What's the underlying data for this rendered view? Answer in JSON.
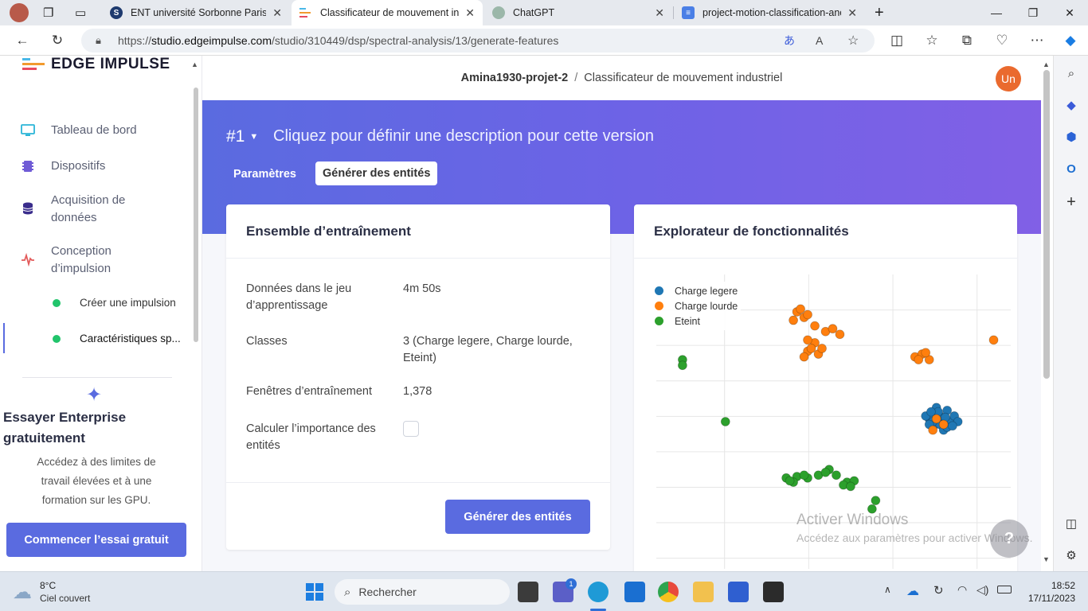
{
  "browser": {
    "tabs": [
      {
        "title": "ENT université Sorbonne Paris No",
        "icon": "sorbonne-icon",
        "color": "#1e3a6e"
      },
      {
        "title": "Classificateur de mouvement ind",
        "icon": "edge-impulse-icon",
        "color": "#ffffff",
        "active": true
      },
      {
        "title": "ChatGPT",
        "icon": "chatgpt-icon",
        "color": "#9bb7a9"
      },
      {
        "title": "project-motion-classification-anc",
        "icon": "docs-icon",
        "color": "#4a7fe6"
      }
    ],
    "url_prefix": "https://",
    "url_host": "studio.edgeimpulse.com",
    "url_path": "/studio/310449/dsp/spectral-analysis/13/generate-features"
  },
  "sidebar": {
    "logo": "EDGE IMPULSE",
    "items": [
      {
        "label": "Tableau de bord",
        "icon": "monitor-icon",
        "color": "#2bb5d8"
      },
      {
        "label": "Dispositifs",
        "icon": "chip-icon",
        "color": "#6f5bd6"
      },
      {
        "label": "Acquisition de\ndonnées",
        "icon": "database-icon",
        "color": "#3a2d8c"
      },
      {
        "label": "Conception\nd’impulsion",
        "icon": "pulse-icon",
        "color": "#e35b5b"
      }
    ],
    "subitems": [
      {
        "label": "Créer une impulsion"
      },
      {
        "label": "Caractéristiques sp..."
      }
    ],
    "enterprise_title": "Essayer Enterprise\ngratuitement",
    "enterprise_desc": "Accédez à des limites de\ntravail élevées et à une\nformation sur les GPU.",
    "enterprise_button": "Commencer l’essai gratuit"
  },
  "header": {
    "project": "Amina1930-projet-2",
    "separator": "/",
    "title": "Classificateur de mouvement industriel",
    "avatar": "Un"
  },
  "version": {
    "number": "#1",
    "description": "Cliquez pour définir une description pour cette version",
    "tabs": [
      "Paramètres",
      "Générer des entités"
    ]
  },
  "training": {
    "title": "Ensemble d’entraînement",
    "rows": [
      {
        "label": "Données dans le jeu\nd’apprentissage",
        "value": "4m 50s"
      },
      {
        "label": "Classes",
        "value": "3 (Charge legere, Charge lourde,\nEteint)"
      },
      {
        "label": "Fenêtres d’entraînement",
        "value": "1,378"
      },
      {
        "label": "Calculer l’importance des\nentités",
        "value": ""
      }
    ],
    "button": "Générer des entités"
  },
  "explorer": {
    "title": "Explorateur de fonctionnalités",
    "watermark_title": "Activer Windows",
    "watermark_desc": "Accédez aux paramètres pour activer Windows."
  },
  "chart_data": {
    "type": "scatter",
    "title": "",
    "xlabel": "",
    "ylabel": "",
    "grid": true,
    "legend": "top-left",
    "xlim": [
      0,
      10
    ],
    "ylim": [
      0,
      10
    ],
    "series": [
      {
        "name": "Charge legere",
        "color": "#1f77b4",
        "points": [
          [
            7.9,
            5.1
          ],
          [
            8.1,
            5.3
          ],
          [
            8.3,
            5.0
          ],
          [
            8.0,
            4.8
          ],
          [
            8.4,
            5.4
          ],
          [
            8.2,
            4.9
          ],
          [
            7.8,
            5.2
          ],
          [
            8.5,
            5.0
          ],
          [
            8.1,
            5.5
          ],
          [
            8.3,
            4.7
          ],
          [
            8.6,
            5.2
          ],
          [
            8.0,
            5.0
          ],
          [
            7.9,
            4.9
          ],
          [
            8.2,
            5.2
          ],
          [
            8.4,
            4.8
          ],
          [
            8.7,
            5.0
          ],
          [
            8.15,
            5.35
          ],
          [
            8.35,
            5.15
          ],
          [
            8.55,
            4.85
          ],
          [
            7.95,
            5.35
          ]
        ]
      },
      {
        "name": "Charge lourde",
        "color": "#ff7f0e",
        "points": [
          [
            4.2,
            8.9
          ],
          [
            4.4,
            8.7
          ],
          [
            4.1,
            8.6
          ],
          [
            4.3,
            9.0
          ],
          [
            4.5,
            8.8
          ],
          [
            5.0,
            8.2
          ],
          [
            5.2,
            8.3
          ],
          [
            5.4,
            8.1
          ],
          [
            4.5,
            7.5
          ],
          [
            4.7,
            7.8
          ],
          [
            4.4,
            7.3
          ],
          [
            4.6,
            7.6
          ],
          [
            4.8,
            7.4
          ],
          [
            4.5,
            7.9
          ],
          [
            4.9,
            7.6
          ],
          [
            7.5,
            7.3
          ],
          [
            7.7,
            7.4
          ],
          [
            7.9,
            7.2
          ],
          [
            7.6,
            7.2
          ],
          [
            7.8,
            7.45
          ],
          [
            9.7,
            7.9
          ],
          [
            8.1,
            5.1
          ],
          [
            8.3,
            4.9
          ],
          [
            8.0,
            4.7
          ],
          [
            4.7,
            8.4
          ]
        ]
      },
      {
        "name": "Eteint",
        "color": "#2ca02c",
        "points": [
          [
            1.0,
            7.2
          ],
          [
            1.0,
            7.0
          ],
          [
            2.2,
            5.0
          ],
          [
            3.9,
            3.0
          ],
          [
            4.2,
            3.05
          ],
          [
            4.1,
            2.85
          ],
          [
            4.5,
            3.0
          ],
          [
            4.8,
            3.1
          ],
          [
            5.1,
            3.3
          ],
          [
            5.3,
            3.1
          ],
          [
            5.6,
            2.85
          ],
          [
            5.8,
            2.9
          ],
          [
            5.5,
            2.75
          ],
          [
            4.0,
            2.9
          ],
          [
            4.4,
            3.1
          ],
          [
            5.0,
            3.2
          ],
          [
            5.7,
            2.7
          ],
          [
            6.4,
            2.2
          ],
          [
            6.3,
            1.9
          ]
        ]
      }
    ]
  },
  "taskbar": {
    "weather_temp": "8°C",
    "weather_desc": "Ciel couvert",
    "search": "Rechercher",
    "time": "18:52",
    "date": "17/11/2023",
    "notif_count": "1"
  }
}
